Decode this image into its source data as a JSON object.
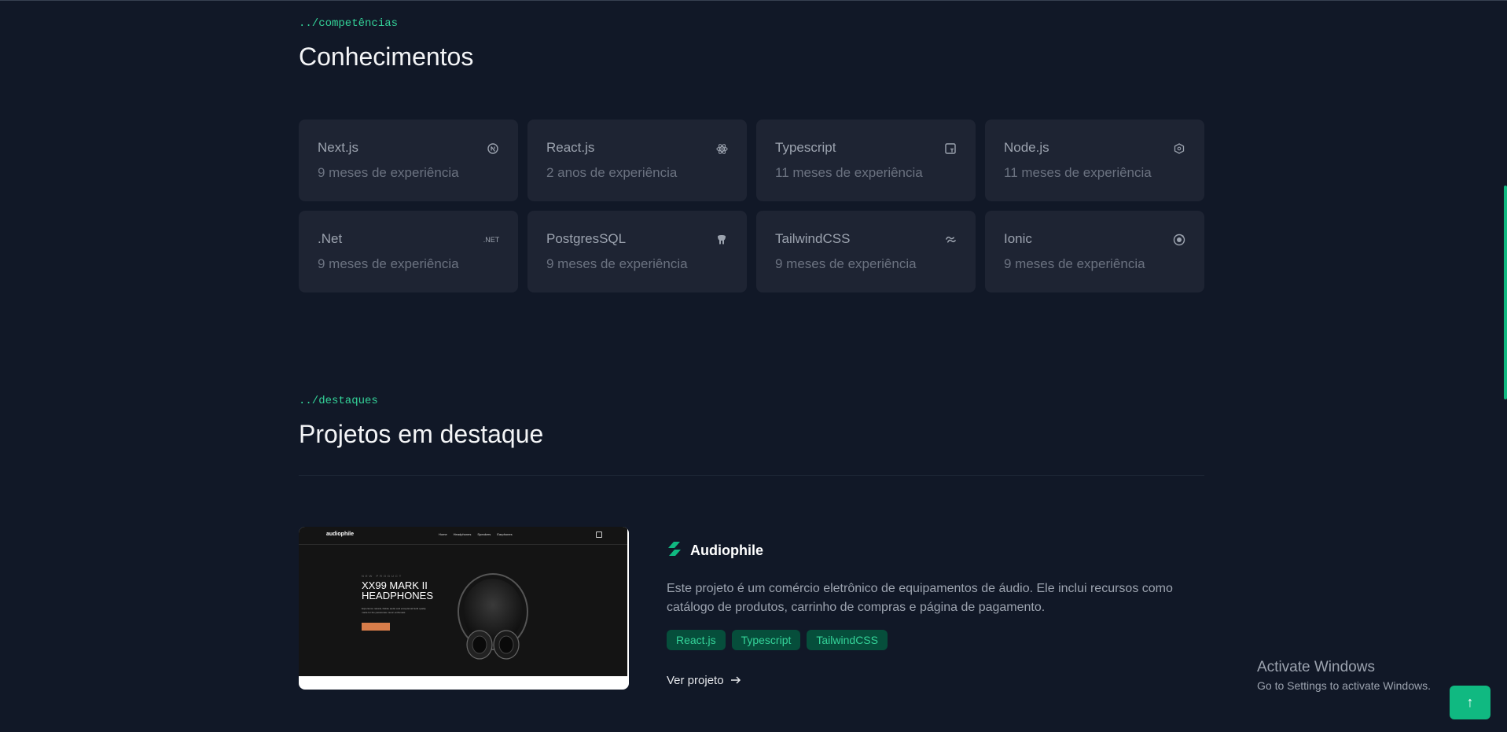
{
  "skills_section": {
    "breadcrumb": "../competências",
    "title": "Conhecimentos",
    "cards": [
      {
        "name": "Next.js",
        "experience": "9 meses de experiência",
        "icon": "nextjs-icon"
      },
      {
        "name": "React.js",
        "experience": "2 anos de experiência",
        "icon": "react-icon"
      },
      {
        "name": "Typescript",
        "experience": "11 meses de experiência",
        "icon": "typescript-icon"
      },
      {
        "name": "Node.js",
        "experience": "11 meses de experiência",
        "icon": "nodejs-icon"
      },
      {
        "name": ".Net",
        "experience": "9 meses de experiência",
        "icon": "dotnet-icon",
        "icon_text": ".NET"
      },
      {
        "name": "PostgresSQL",
        "experience": "9 meses de experiência",
        "icon": "postgresql-icon"
      },
      {
        "name": "TailwindCSS",
        "experience": "9 meses de experiência",
        "icon": "tailwind-icon"
      },
      {
        "name": "Ionic",
        "experience": "9 meses de experiência",
        "icon": "ionic-icon"
      }
    ]
  },
  "projects_section": {
    "breadcrumb": "../destaques",
    "title": "Projetos em destaque",
    "project": {
      "title": "Audiophile",
      "description": "Este projeto é um comércio eletrônico de equipamentos de áudio. Ele inclui recursos como catálogo de produtos, carrinho de compras e página de pagamento.",
      "tags": [
        "React.js",
        "Typescript",
        "TailwindCSS"
      ],
      "link_label": "Ver projeto",
      "thumbnail": {
        "logo": "audiophile",
        "nav_links": [
          "Home",
          "Headphones",
          "Speakers",
          "Earphones"
        ],
        "overline": "NEW PRODUCT",
        "headline_1": "XX99 MARK II",
        "headline_2": "HEADPHONES",
        "copy": "Experience natural, lifelike audio and exceptional build quality made for the passionate music enthusiast.",
        "button": "SEE PRODUCT"
      }
    }
  },
  "os_watermark": {
    "line1": "Activate Windows",
    "line2": "Go to Settings to activate Windows."
  },
  "back_to_top": {
    "icon": "arrow-up-icon",
    "glyph": "↑"
  },
  "colors": {
    "accent": "#10b981",
    "background": "#111827",
    "card": "#1e2433"
  }
}
